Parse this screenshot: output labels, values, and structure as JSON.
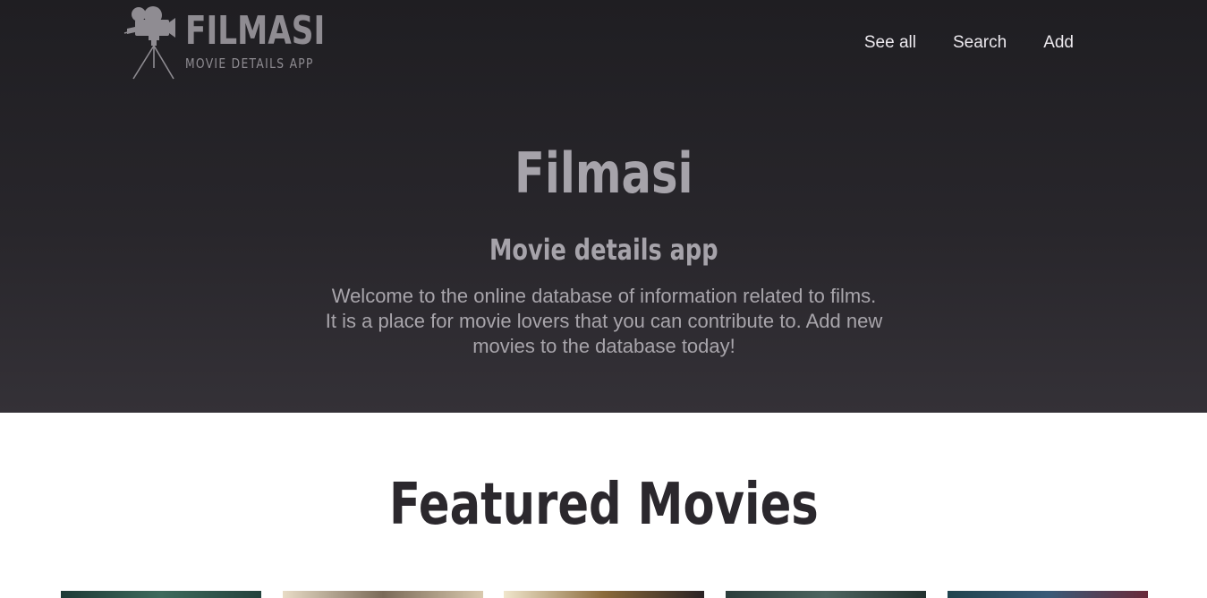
{
  "brand": {
    "name": "FILMASI",
    "tagline": "MOVIE DETAILS APP",
    "logo_icon": "movie-camera-on-tripod-icon"
  },
  "nav": {
    "items": [
      "See all",
      "Search",
      "Add"
    ]
  },
  "hero": {
    "title": "Filmasi",
    "subtitle": "Movie details app",
    "paragraph_1": "Welcome to the online database of information related to films.",
    "paragraph_2": "It is a place for movie lovers that you can contribute to. Add new movies to the database today!"
  },
  "featured": {
    "title": "Featured Movies",
    "posters": [
      {
        "name": "poster-1",
        "colors": [
          "#1e3a36",
          "#3e6a5c",
          "#24423d"
        ]
      },
      {
        "name": "poster-2",
        "colors": [
          "#e8dcc6",
          "#7a6a58",
          "#d9c9ae"
        ]
      },
      {
        "name": "poster-3",
        "colors": [
          "#f0e6cc",
          "#8a6a3a",
          "#2a2224"
        ]
      },
      {
        "name": "poster-4",
        "colors": [
          "#2b3d3b",
          "#4d6560",
          "#233230"
        ]
      },
      {
        "name": "poster-5",
        "colors": [
          "#20444e",
          "#3a5a78",
          "#6a2a3a"
        ]
      }
    ]
  },
  "colors": {
    "hero_bg_top": "#1f1e22",
    "hero_bg_bottom": "#343137",
    "hero_text": "#a6a3aa",
    "nav_text": "#ece9ee",
    "featured_title": "#2b282d"
  }
}
